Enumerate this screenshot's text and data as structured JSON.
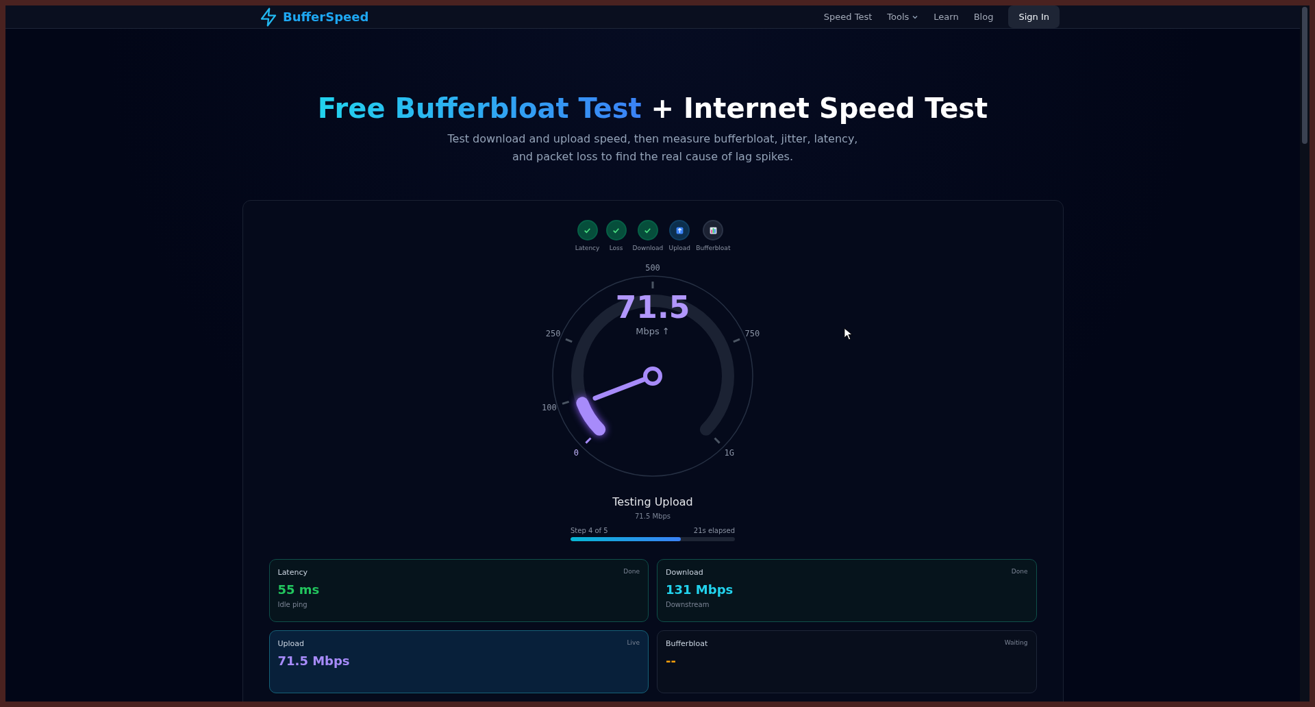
{
  "brand": {
    "name": "BufferSpeed"
  },
  "nav": [
    {
      "label": "Speed Test",
      "has_menu": false
    },
    {
      "label": "Tools",
      "has_menu": true
    },
    {
      "label": "Learn",
      "has_menu": false
    },
    {
      "label": "Blog",
      "has_menu": false
    }
  ],
  "sign_in": "Sign In",
  "hero": {
    "title_highlight": "Free Bufferbloat Test",
    "title_rest": "+ Internet Speed Test",
    "subtitle": "Test download and upload speed, then measure bufferbloat, jitter, latency, and packet loss to find the real cause of lag spikes."
  },
  "steps": [
    {
      "label": "Latency",
      "kind": "done"
    },
    {
      "label": "Loss",
      "kind": "done"
    },
    {
      "label": "Download",
      "kind": "done"
    },
    {
      "label": "Upload",
      "kind": "active"
    },
    {
      "label": "Bufferbloat",
      "kind": "waiting"
    }
  ],
  "gauge": {
    "reading": "71.5",
    "unit": "Mbps ↑",
    "ticks": [
      "0",
      "100",
      "250",
      "500",
      "750",
      "1G"
    ]
  },
  "status": {
    "title": "Testing Upload",
    "detail": "71.5 Mbps",
    "step": "Step 4 of 5",
    "elapsed": "21s elapsed",
    "level": 0.67
  },
  "cards": [
    {
      "label": "Latency",
      "state": "Done",
      "kind": "done",
      "value": "55 ms",
      "color": "#22c55e",
      "note": "Idle ping"
    },
    {
      "label": "Download",
      "state": "Done",
      "kind": "done",
      "value": "131 Mbps",
      "color": "#22d3ee",
      "note": "Downstream"
    },
    {
      "label": "Upload",
      "state": "Live",
      "kind": "live",
      "value": "71.5 Mbps",
      "color": "#a78bfa"
    },
    {
      "label": "Bufferbloat",
      "state": "Waiting",
      "kind": "waiting",
      "value": "--",
      "color": "#f59e0b"
    }
  ]
}
